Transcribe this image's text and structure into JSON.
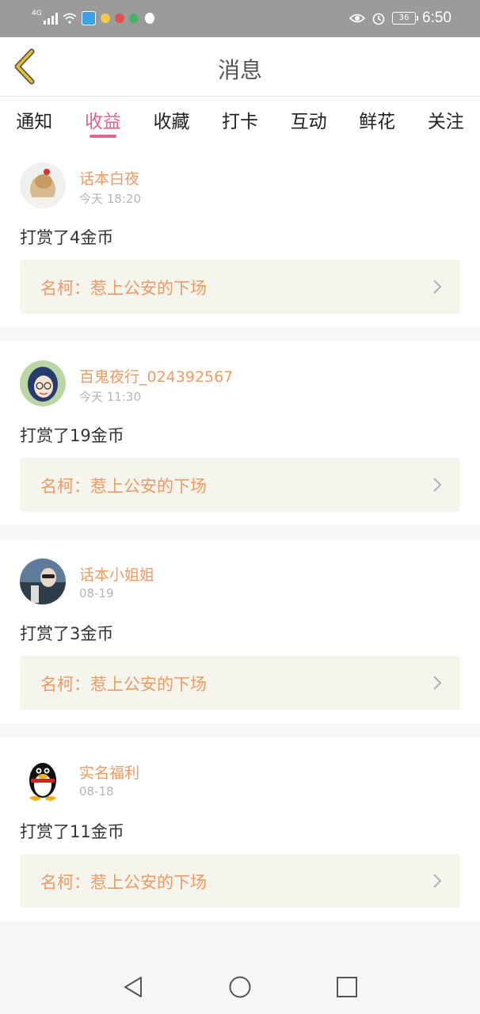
{
  "status_bar": {
    "network": "4G",
    "battery": "36",
    "time": "6:50"
  },
  "header": {
    "title": "消息"
  },
  "tabs": [
    {
      "label": "通知",
      "active": false
    },
    {
      "label": "收益",
      "active": true
    },
    {
      "label": "收藏",
      "active": false
    },
    {
      "label": "打卡",
      "active": false
    },
    {
      "label": "互动",
      "active": false
    },
    {
      "label": "鲜花",
      "active": false
    },
    {
      "label": "关注",
      "active": false
    }
  ],
  "messages": [
    {
      "user": "话本白夜",
      "time": "今天 18:20",
      "text": "打赏了4金币",
      "ref": "名柯：惹上公安的下场"
    },
    {
      "user": "百鬼夜行_024392567",
      "time": "今天 11:30",
      "text": "打赏了19金币",
      "ref": "名柯：惹上公安的下场"
    },
    {
      "user": "话本小姐姐",
      "time": "08-19",
      "text": "打赏了3金币",
      "ref": "名柯：惹上公安的下场"
    },
    {
      "user": "实名福利",
      "time": "08-18",
      "text": "打赏了11金币",
      "ref": "名柯：惹上公安的下场"
    }
  ],
  "colors": {
    "accent": "#e4628f",
    "name": "#ee9a62",
    "back": "#e8b818"
  }
}
